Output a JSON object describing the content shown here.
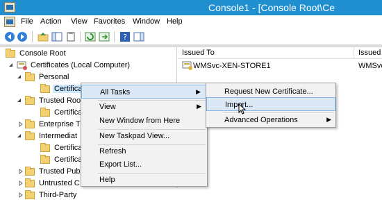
{
  "window": {
    "title": "Console1 - [Console Root\\Ce"
  },
  "menu": [
    "File",
    "Action",
    "View",
    "Favorites",
    "Window",
    "Help"
  ],
  "toolbar": {
    "icons": [
      "back-arrow-icon",
      "forward-arrow-icon",
      "up-folder-icon",
      "show-hide-tree-icon",
      "copy-icon",
      "refresh-icon",
      "export-list-icon",
      "help-icon",
      "show-action-pane-icon"
    ]
  },
  "tree": [
    {
      "label": "Console Root"
    },
    {
      "label": "Certificates (Local Computer)"
    },
    {
      "label": "Personal"
    },
    {
      "label": "Certifica"
    },
    {
      "label": "Trusted Roo"
    },
    {
      "label": "Certifica"
    },
    {
      "label": "Enterprise T"
    },
    {
      "label": "Intermediat"
    },
    {
      "label": "Certifica"
    },
    {
      "label": "Certifica"
    },
    {
      "label": "Trusted Pub"
    },
    {
      "label": "Untrusted C"
    },
    {
      "label": "Third-Party"
    }
  ],
  "list": {
    "columns": [
      "Issued To",
      "Issued"
    ],
    "rows": [
      {
        "issued_to": "WMSvc-XEN-STORE1",
        "issued_by": "WMSvc"
      }
    ]
  },
  "context_menu": {
    "items": [
      "All Tasks",
      "View",
      "New Window from Here",
      "New Taskpad View...",
      "Refresh",
      "Export List...",
      "Help"
    ]
  },
  "submenu": {
    "items": [
      "Request New Certificate...",
      "Import...",
      "Advanced Operations"
    ]
  },
  "colors": {
    "titlebar": "#1f8fd0",
    "highlight": "#dbe9f7",
    "highlight_border": "#7eb4ea"
  }
}
